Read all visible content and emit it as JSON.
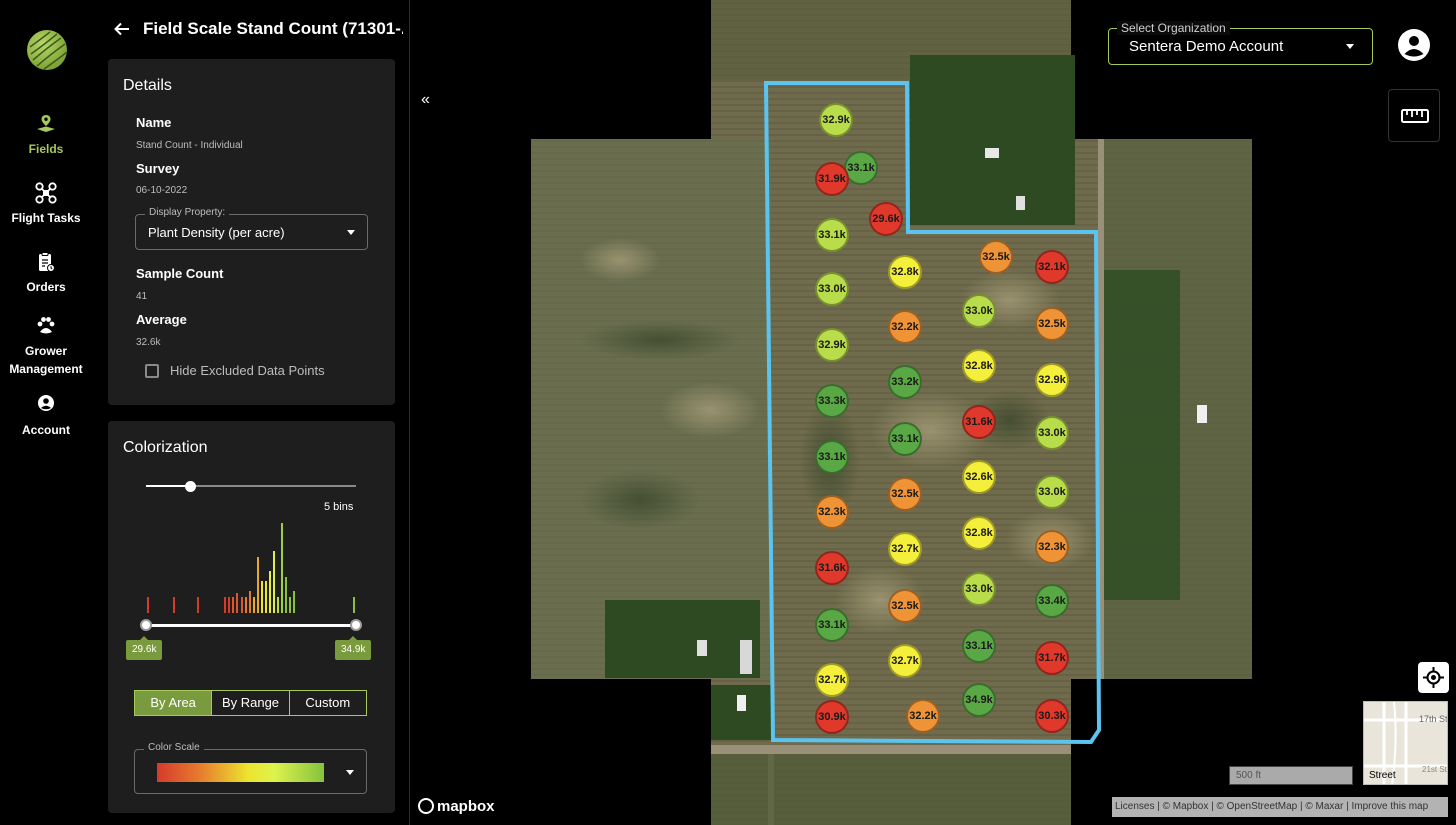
{
  "nav": {
    "items": [
      {
        "label": "Fields",
        "icon": "field-pin-icon"
      },
      {
        "label": "Flight Tasks",
        "icon": "drone-icon"
      },
      {
        "label": "Orders",
        "icon": "clipboard-icon"
      },
      {
        "label": "Grower Management",
        "icon": "growers-icon"
      },
      {
        "label": "Account",
        "icon": "account-circle-icon"
      }
    ]
  },
  "header": {
    "title": "Field Scale Stand Count (71301-..."
  },
  "details": {
    "title": "Details",
    "name_label": "Name",
    "name_value": "Stand Count - Individual",
    "survey_label": "Survey",
    "survey_value": "06-10-2022",
    "display_property_legend": "Display Property:",
    "display_property_value": "Plant Density (per acre)",
    "sample_count_label": "Sample Count",
    "sample_count_value": "41",
    "average_label": "Average",
    "average_value": "32.6k",
    "hide_excluded_label": "Hide Excluded Data Points",
    "hide_excluded_checked": false
  },
  "colorization": {
    "title": "Colorization",
    "bins_label": "5 bins",
    "bins_level": 0.2,
    "range_min_label": "29.6k",
    "range_max_label": "34.9k",
    "modes": [
      "By Area",
      "By Range",
      "Custom"
    ],
    "active_mode": "By Area",
    "color_scale_legend": "Color Scale",
    "scale_colors": [
      "#d63a2b",
      "#e67a2e",
      "#ece52f",
      "#dff24c",
      "#86c23f"
    ]
  },
  "map": {
    "org_legend": "Select Organization",
    "org_value": "Sentera Demo Account",
    "minimap_label": "Street",
    "scale_label": "500 ft",
    "attribution": "Licenses | © Mapbox | © OpenStreetMap | © Maxar | Improve this map",
    "logo_text": "mapbox",
    "markers": [
      {
        "label": "32.9k",
        "color": "#b8dc4a"
      },
      {
        "label": "33.1k",
        "color": "#5aa845"
      },
      {
        "label": "31.9k",
        "color": "#e0392b"
      },
      {
        "label": "29.6k",
        "color": "#e0392b"
      },
      {
        "label": "33.1k",
        "color": "#b8dc4a"
      },
      {
        "label": "33.0k",
        "color": "#b8dc4a"
      },
      {
        "label": "32.9k",
        "color": "#b8dc4a"
      },
      {
        "label": "33.3k",
        "color": "#5aa845"
      },
      {
        "label": "33.1k",
        "color": "#5aa845"
      },
      {
        "label": "32.3k",
        "color": "#ef9436"
      },
      {
        "label": "31.6k",
        "color": "#e0392b"
      },
      {
        "label": "33.1k",
        "color": "#5aa845"
      },
      {
        "label": "32.7k",
        "color": "#f4ef3b"
      },
      {
        "label": "30.9k",
        "color": "#e0392b"
      },
      {
        "label": "32.8k",
        "color": "#f4ef3b"
      },
      {
        "label": "32.2k",
        "color": "#ef9436"
      },
      {
        "label": "33.2k",
        "color": "#5aa845"
      },
      {
        "label": "33.1k",
        "color": "#5aa845"
      },
      {
        "label": "32.5k",
        "color": "#ef9436"
      },
      {
        "label": "32.7k",
        "color": "#f4ef3b"
      },
      {
        "label": "32.5k",
        "color": "#ef9436"
      },
      {
        "label": "32.7k",
        "color": "#f4ef3b"
      },
      {
        "label": "32.2k",
        "color": "#ef9436"
      },
      {
        "label": "32.5k",
        "color": "#ef9436"
      },
      {
        "label": "33.0k",
        "color": "#b8dc4a"
      },
      {
        "label": "32.8k",
        "color": "#f4ef3b"
      },
      {
        "label": "31.6k",
        "color": "#e0392b"
      },
      {
        "label": "32.6k",
        "color": "#f4ef3b"
      },
      {
        "label": "32.8k",
        "color": "#f4ef3b"
      },
      {
        "label": "33.0k",
        "color": "#b8dc4a"
      },
      {
        "label": "33.1k",
        "color": "#5aa845"
      },
      {
        "label": "34.9k",
        "color": "#5aa845"
      },
      {
        "label": "32.1k",
        "color": "#e0392b"
      },
      {
        "label": "32.5k",
        "color": "#ef9436"
      },
      {
        "label": "32.9k",
        "color": "#f4ef3b"
      },
      {
        "label": "33.0k",
        "color": "#b8dc4a"
      },
      {
        "label": "33.0k",
        "color": "#b8dc4a"
      },
      {
        "label": "32.3k",
        "color": "#ef9436"
      },
      {
        "label": "33.4k",
        "color": "#5aa845"
      },
      {
        "label": "31.7k",
        "color": "#e0392b"
      },
      {
        "label": "30.3k",
        "color": "#e0392b"
      }
    ]
  }
}
